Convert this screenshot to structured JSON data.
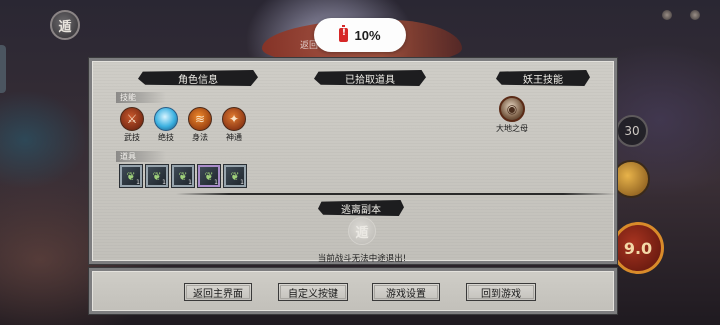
{
  "status_toast": {
    "battery_percent": "10%",
    "battery_icon": "battery-low-icon",
    "battery_color": "#d62828"
  },
  "background": {
    "caption": "返回",
    "hud_button": "遁",
    "cooldown": "30",
    "ult_label": "9.0"
  },
  "panel": {
    "role_info_header": "角色信息",
    "picked_items_header": "已拾取道具",
    "boss_skill_header": "妖王技能",
    "skills_label": "技能",
    "props_label": "道具",
    "skills": [
      {
        "name": "武技",
        "icon": "martial-skill-icon"
      },
      {
        "name": "绝技",
        "icon": "ultimate-skill-icon"
      },
      {
        "name": "身法",
        "icon": "movement-skill-icon"
      },
      {
        "name": "神通",
        "icon": "divine-skill-icon"
      }
    ],
    "props": [
      {
        "icon": "herb-icon",
        "count": "1",
        "rarity": "common"
      },
      {
        "icon": "herb-icon",
        "count": "1",
        "rarity": "common"
      },
      {
        "icon": "herb-icon",
        "count": "1",
        "rarity": "common"
      },
      {
        "icon": "herb-icon",
        "count": "1",
        "rarity": "epic"
      },
      {
        "icon": "herb-icon",
        "count": "1",
        "rarity": "common"
      }
    ],
    "boss_skill": {
      "name": "大地之母",
      "icon": "earth-mother-icon"
    },
    "escape": {
      "header": "逃离副本",
      "button_glyph": "遁",
      "note": "当前战斗无法中途退出!"
    }
  },
  "bottom_bar": {
    "return_main": "返回主界面",
    "custom_keys": "自定义按键",
    "game_settings": "游戏设置",
    "return_game": "回到游戏"
  }
}
